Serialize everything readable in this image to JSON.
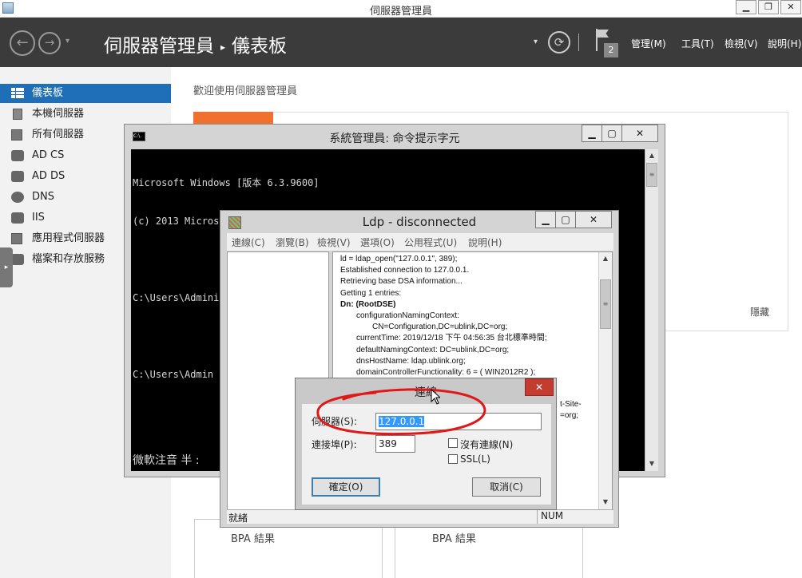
{
  "window": {
    "title": "伺服器管理員",
    "min": "▁",
    "max": "❐",
    "close": "✕"
  },
  "header": {
    "breadcrumb_root": "伺服器管理員",
    "breadcrumb_sep": "▸",
    "breadcrumb_page": "儀表板",
    "back": "←",
    "forward": "→",
    "dropdown": "▾",
    "refresh": "⟳",
    "notifications_count": "2",
    "menus": [
      "管理(M)",
      "工具(T)",
      "檢視(V)",
      "說明(H)"
    ]
  },
  "sidebar": {
    "items": [
      {
        "label": "儀表板",
        "icon": "dashboard-icon"
      },
      {
        "label": "本機伺服器",
        "icon": "server-icon"
      },
      {
        "label": "所有伺服器",
        "icon": "servers-icon"
      },
      {
        "label": "AD CS",
        "icon": "adcs-icon"
      },
      {
        "label": "AD DS",
        "icon": "adds-icon"
      },
      {
        "label": "DNS",
        "icon": "dns-icon"
      },
      {
        "label": "IIS",
        "icon": "iis-icon"
      },
      {
        "label": "應用程式伺服器",
        "icon": "app-server-icon"
      },
      {
        "label": "檔案和存放服務",
        "icon": "file-storage-icon"
      }
    ],
    "collapse": "▸"
  },
  "dashboard": {
    "welcome": "歡迎使用伺服器管理員",
    "hide": "隱藏",
    "tiles": [
      {
        "label": "BPA 結果"
      },
      {
        "label": "BPA 結果"
      }
    ]
  },
  "cmd": {
    "title": "系統管理員: 命令提示字元",
    "icon_text": "C:\\.",
    "min": "▁",
    "max": "▢",
    "close": "✕",
    "lines": [
      "Microsoft Windows [版本 6.3.9600]",
      "(c) 2013 Microsoft Corporation. All rights reserved.",
      "",
      "C:\\Users\\Administrator>ldp.exe",
      "",
      "C:\\Users\\Admin"
    ],
    "ime": "微軟注音 半 :"
  },
  "ldp": {
    "title": "Ldp - disconnected",
    "min": "▁",
    "max": "▢",
    "close": "✕",
    "menus": [
      "連線(C)",
      "瀏覽(B)",
      "檢視(V)",
      "選項(O)",
      "公用程式(U)",
      "說明(H)"
    ],
    "output": [
      {
        "text": "ld = ldap_open(\"127.0.0.1\", 389);",
        "style": ""
      },
      {
        "text": "Established connection to 127.0.0.1.",
        "style": ""
      },
      {
        "text": "Retrieving base DSA information...",
        "style": ""
      },
      {
        "text": "Getting 1 entries:",
        "style": ""
      },
      {
        "text": "Dn: (RootDSE)",
        "style": "bold"
      },
      {
        "text": "configurationNamingContext:",
        "style": "i1"
      },
      {
        "text": "CN=Configuration,DC=ublink,DC=org;",
        "style": "i2"
      },
      {
        "text": "currentTime: 2019/12/18 下午 04:56:35 台北標準時間;",
        "style": "i1"
      },
      {
        "text": "defaultNamingContext: DC=ublink,DC=org;",
        "style": "i1"
      },
      {
        "text": "dnsHostName: ldap.ublink.org;",
        "style": "i1"
      },
      {
        "text": "domainControllerFunctionality: 6 = ( WIN2012R2 );",
        "style": "i1"
      }
    ],
    "output_partial": [
      "t-Site-",
      "=org;"
    ],
    "status": "就緒",
    "num": "NUM"
  },
  "connect_dialog": {
    "title": "連線",
    "close": "✕",
    "server_label": "伺服器(S):",
    "server_value": "127.0.0.1",
    "port_label": "連接埠(P):",
    "port_value": "389",
    "connectionless_label": "沒有連線(N)",
    "connectionless_checked": false,
    "ssl_label": "SSL(L)",
    "ssl_checked": false,
    "ok_label": "確定(O)",
    "cancel_label": "取消(C)"
  },
  "colors": {
    "header_bg": "#3b3b3b",
    "active_nav": "#1e6fb8",
    "accent_orange": "#f07030",
    "annotation_red": "#e01818",
    "dialog_close": "#c43b30",
    "selection": "#3399ff"
  }
}
